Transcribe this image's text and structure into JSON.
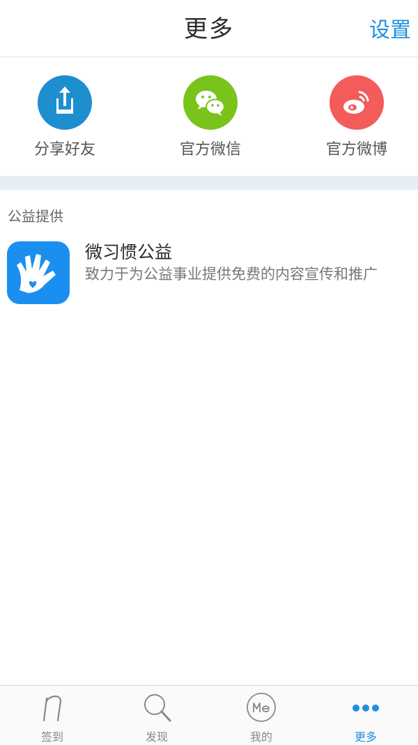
{
  "header": {
    "title": "更多",
    "settings_label": "设置"
  },
  "share": {
    "items": [
      {
        "label": "分享好友",
        "icon": "share-icon",
        "color": "#1d8fcf"
      },
      {
        "label": "官方微信",
        "icon": "wechat-icon",
        "color": "#79c31a"
      },
      {
        "label": "官方微博",
        "icon": "weibo-icon",
        "color": "#f45b5b"
      }
    ]
  },
  "charity": {
    "section_title": "公益提供",
    "app": {
      "name": "微习惯公益",
      "description": "致力于为公益事业提供免费的内容宣传和推广",
      "icon": "hand-heart-icon",
      "color": "#1b8ff0"
    }
  },
  "tabs": [
    {
      "label": "签到",
      "icon": "checkin-icon",
      "active": false
    },
    {
      "label": "发现",
      "icon": "search-icon",
      "active": false
    },
    {
      "label": "我的",
      "icon": "me-icon",
      "active": false
    },
    {
      "label": "更多",
      "icon": "more-dots-icon",
      "active": true
    }
  ],
  "colors": {
    "accent": "#1d8fe0",
    "separator": "#e5eef5"
  }
}
